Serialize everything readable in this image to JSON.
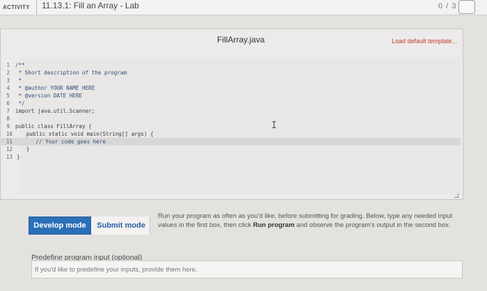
{
  "header": {
    "badge": "ACTIVITY",
    "title": "11.13.1: Fill an Array - Lab",
    "score": "0 / 3"
  },
  "editor": {
    "file_name": "FillArray.java",
    "load_template_label": "Load default template...",
    "lines": [
      {
        "num": "1",
        "text": "/**",
        "style": "comment"
      },
      {
        "num": "2",
        "text": " * Short description of the program",
        "style": "comment"
      },
      {
        "num": "3",
        "text": " *",
        "style": "comment"
      },
      {
        "num": "4",
        "text": " * @author YOUR NAME HERE",
        "style": "comment"
      },
      {
        "num": "5",
        "text": " * @version DATE HERE",
        "style": "comment"
      },
      {
        "num": "6",
        "text": " */",
        "style": "comment"
      },
      {
        "num": "7",
        "text": "import java.util.Scanner;",
        "style": "plain"
      },
      {
        "num": "8",
        "text": "",
        "style": "plain"
      },
      {
        "num": "9",
        "text": "public class FillArray {",
        "style": "plain"
      },
      {
        "num": "10",
        "text": "   public static void main(String[] args) {",
        "style": "plain"
      },
      {
        "num": "11",
        "text": "      // Your code goes here",
        "style": "comment"
      },
      {
        "num": "12",
        "text": "   }",
        "style": "plain"
      },
      {
        "num": "13",
        "text": "}",
        "style": "plain"
      }
    ],
    "active_line": 11
  },
  "modes": {
    "develop_label": "Develop mode",
    "submit_label": "Submit mode",
    "help_prefix": "Run your program as often as you'd like, before submitting for grading. Below, type any needed input values in the first box, then click ",
    "help_bold": "Run program",
    "help_suffix": " and observe the program's output in the second box."
  },
  "input": {
    "label": "Predefine program input (optional)",
    "placeholder": "If you'd like to predefine your inputs, provide them here."
  },
  "colors": {
    "accent": "#2a6fb7",
    "template_link": "#c53b2b"
  }
}
